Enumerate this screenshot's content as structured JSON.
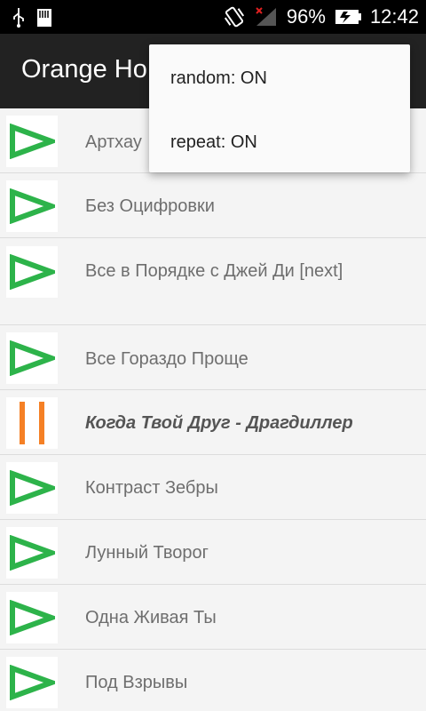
{
  "status_bar": {
    "battery": "96%",
    "time": "12:42",
    "icons": [
      "usb-icon",
      "sd-card-icon",
      "vibrate-icon",
      "no-signal-icon",
      "battery-icon"
    ]
  },
  "action_bar": {
    "title": "Orange Ho"
  },
  "overflow_menu": {
    "items": [
      {
        "label": "random: ON"
      },
      {
        "label": "repeat: ON"
      }
    ]
  },
  "playlist": {
    "items": [
      {
        "title": "Артхау",
        "state": "play"
      },
      {
        "title": "Без Оцифровки",
        "state": "play"
      },
      {
        "title": "Все в Порядке с Джей Ди [next]",
        "state": "play"
      },
      {
        "title": "Все Гораздо Проще",
        "state": "play"
      },
      {
        "title": "Когда Твой Друг - Драгдиллер",
        "state": "pause"
      },
      {
        "title": "Контраст Зебры",
        "state": "play"
      },
      {
        "title": "Лунный Творог",
        "state": "play"
      },
      {
        "title": "Одна Живая Ты",
        "state": "play"
      },
      {
        "title": "Под Взрывы",
        "state": "play"
      }
    ]
  },
  "colors": {
    "play_icon": "#2db34a",
    "pause_icon": "#f58025",
    "action_bar": "#222222",
    "status_bar": "#000000"
  }
}
